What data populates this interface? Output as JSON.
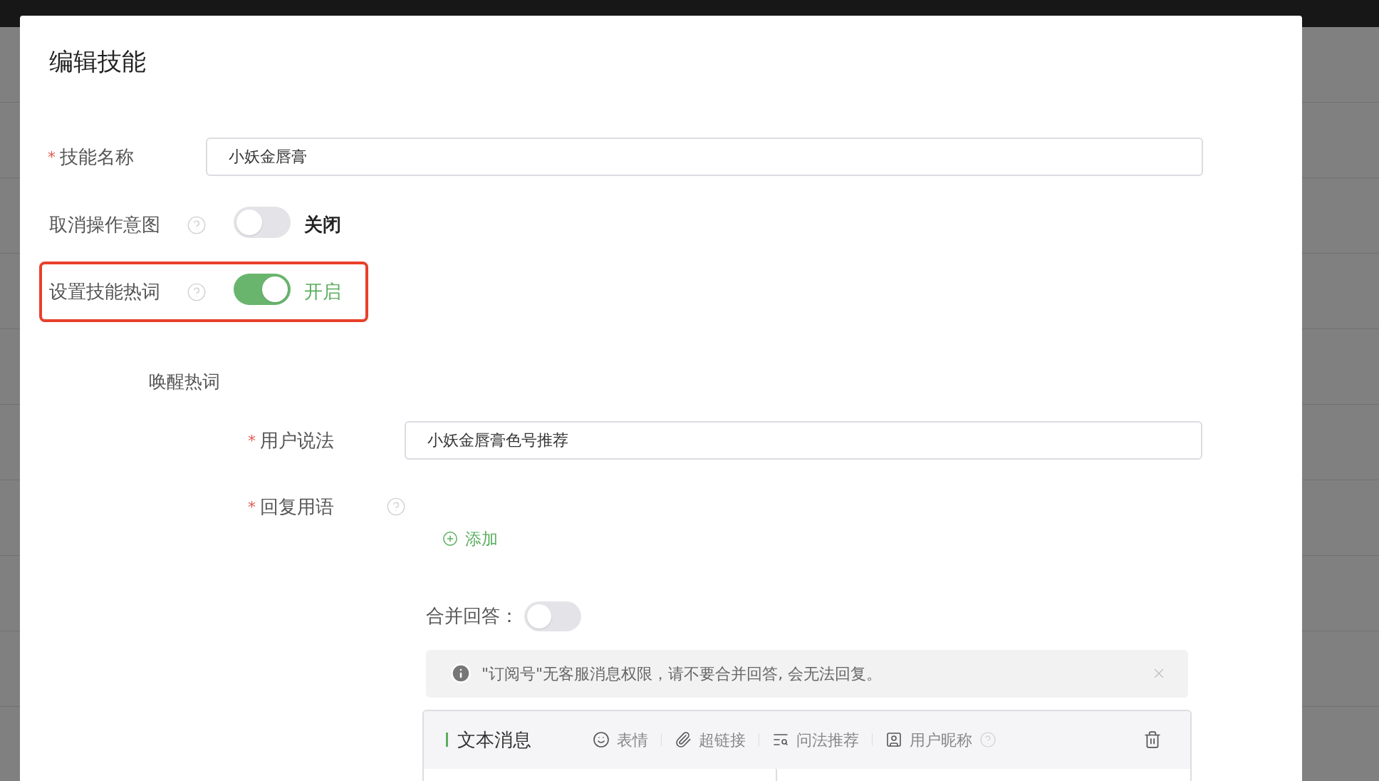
{
  "dialog": {
    "title": "编辑技能"
  },
  "skill_name": {
    "label": "技能名称",
    "required_mark": "*",
    "value": "小妖金唇膏"
  },
  "switches": [
    {
      "label": "取消操作意图",
      "help": true,
      "on": false,
      "state_text": "关闭",
      "highlighted": false
    },
    {
      "label": "设置技能热词",
      "help": true,
      "on": true,
      "state_text": "开启",
      "highlighted": true
    }
  ],
  "hotword": {
    "title": "唤醒热词",
    "utterance": {
      "label": "用户说法",
      "required_mark": "*",
      "value": "小妖金唇膏色号推荐"
    },
    "reply": {
      "label": "回复用语",
      "required_mark": "*",
      "help": true,
      "add_label": "添加"
    },
    "merge": {
      "label": "合并回答：",
      "on": false
    },
    "alert": {
      "text": "\"订阅号\"无客服消息权限，请不要合并回答, 会无法回复。"
    },
    "editor": {
      "title": "文本消息",
      "tools": [
        {
          "kind": "emoji",
          "label": "表情",
          "help": false
        },
        {
          "kind": "link",
          "label": "超链接",
          "help": false
        },
        {
          "kind": "search",
          "label": "问法推荐",
          "help": false
        },
        {
          "kind": "user",
          "label": "用户昵称",
          "help": true
        }
      ]
    }
  }
}
